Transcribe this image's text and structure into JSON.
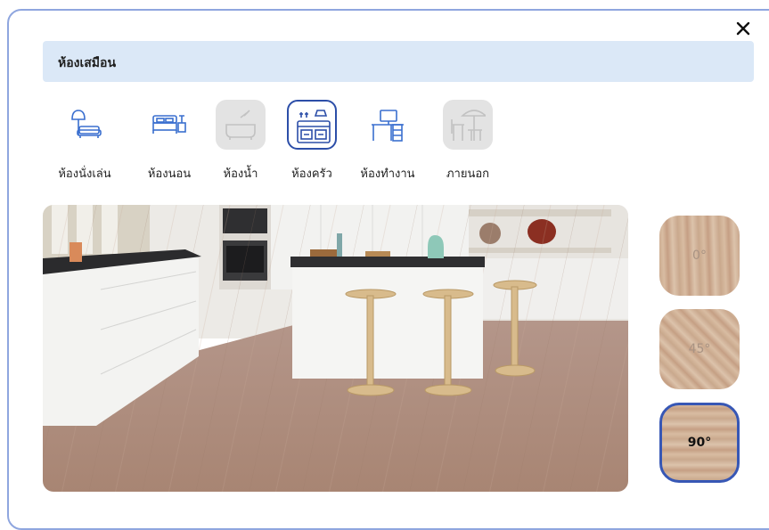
{
  "header": {
    "title": "ห้องเสมือน"
  },
  "rooms": [
    {
      "label": "ห้องนั่งเล่น",
      "icon": "sofa-lamp-icon",
      "state": "normal"
    },
    {
      "label": "ห้องนอน",
      "icon": "bed-icon",
      "state": "normal"
    },
    {
      "label": "ห้องน้ำ",
      "icon": "bathtub-icon",
      "state": "disabled"
    },
    {
      "label": "ห้องครัว",
      "icon": "kitchen-stove-icon",
      "state": "active"
    },
    {
      "label": "ห้องทำงาน",
      "icon": "desk-computer-icon",
      "state": "normal"
    },
    {
      "label": "ภายนอก",
      "icon": "patio-umbrella-icon",
      "state": "disabled"
    }
  ],
  "angles": [
    {
      "label": "0°",
      "selected": false
    },
    {
      "label": "45°",
      "selected": false
    },
    {
      "label": "90°",
      "selected": true
    }
  ],
  "colors": {
    "accent": "#2c4ea8",
    "header_bg": "#dbe8f7",
    "icon_stroke": "#3a6fcf"
  }
}
